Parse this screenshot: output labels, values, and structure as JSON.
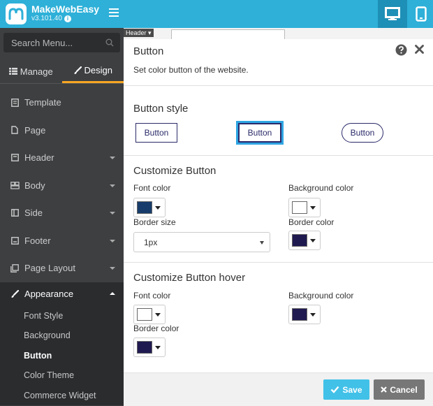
{
  "app": {
    "name": "MakeWebEasy",
    "version": "v3.101.40"
  },
  "topbar": {
    "desktop_icon": "desktop-icon",
    "tablet_icon": "tablet-icon",
    "menu_icon": "hamburger-icon"
  },
  "sidebar": {
    "search_placeholder": "Search Menu...",
    "tabs": [
      {
        "label": "Manage",
        "icon": "list-icon"
      },
      {
        "label": "Design",
        "icon": "brush-icon"
      }
    ],
    "items": [
      {
        "label": "Template",
        "icon": "template-icon"
      },
      {
        "label": "Page",
        "icon": "page-icon"
      },
      {
        "label": "Header",
        "icon": "header-icon"
      },
      {
        "label": "Body",
        "icon": "body-icon"
      },
      {
        "label": "Side",
        "icon": "side-icon"
      },
      {
        "label": "Footer",
        "icon": "footer-icon"
      },
      {
        "label": "Page Layout",
        "icon": "layout-icon"
      },
      {
        "label": "Appearance",
        "icon": "brush-icon"
      }
    ],
    "submenu": [
      "Font Style",
      "Background",
      "Button",
      "Color Theme",
      "Commerce Widget"
    ]
  },
  "canvas": {
    "header_tag": "Header ▾"
  },
  "dialog": {
    "title": "Button",
    "description": "Set color button of the website.",
    "button_style": {
      "title": "Button style",
      "options": [
        "Button",
        "Button",
        "Button"
      ]
    },
    "customize": {
      "title": "Customize Button",
      "font_color_label": "Font color",
      "font_color": "#173c6b",
      "background_color_label": "Background color",
      "background_color": "#ffffff",
      "border_size_label": "Border size",
      "border_size_value": "1px",
      "border_color_label": "Border color",
      "border_color": "#1f1a50"
    },
    "hover": {
      "title": "Customize Button hover",
      "font_color_label": "Font color",
      "font_color": "#ffffff",
      "background_color_label": "Background color",
      "background_color": "#1f1a50",
      "border_color_label": "Border color",
      "border_color": "#1f1a50"
    },
    "save_label": "Save",
    "cancel_label": "Cancel"
  }
}
